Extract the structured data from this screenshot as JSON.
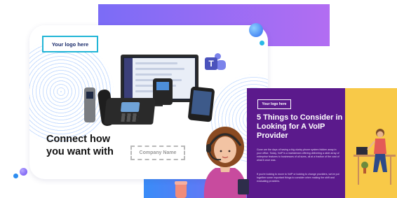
{
  "main_card": {
    "logo_text": "Your logo here",
    "headline_line1": "Connect how",
    "headline_line2": "you want with",
    "company_placeholder": "Company Name"
  },
  "ebook": {
    "logo_text": "Your logo here",
    "title": "5 Things to Consider in Looking for A VoIP Provider",
    "paragraph1": "Gone are the days of having a big clunky phone system hidden away in your office. Today, VoIP is a mainstream offering delivering a wide array of enterprise features to businesses of all sizes, all at a fraction of the cost of what it once was.",
    "paragraph2": "If you're looking to move to VoIP or looking to change providers, we've put together some important things to consider when making the shift and evaluating providers."
  },
  "icons": {
    "teams": "microsoft-teams-icon",
    "teams_letter": "T"
  },
  "colors": {
    "brand_purple": "#5b1a8c",
    "accent_yellow": "#f8c948",
    "logo_border": "#21b5d6",
    "gradient_start": "#7b6cf6",
    "gradient_end": "#b26df2"
  }
}
